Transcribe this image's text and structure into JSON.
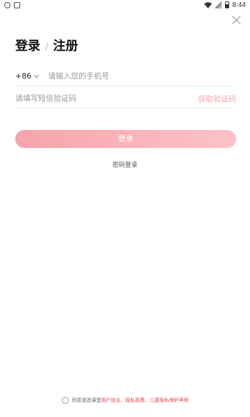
{
  "status_bar": {
    "time": "8:44",
    "left_icons": [
      "message-bubble-icon",
      "a-box-icon"
    ],
    "right_icons": [
      "wifi-icon",
      "no-signal-icon",
      "battery-icon"
    ]
  },
  "header": {
    "title_login": "登录",
    "title_sep": "/",
    "title_register": "注册"
  },
  "phone": {
    "country_code": "+86",
    "placeholder": "请输入您的手机号",
    "value": ""
  },
  "sms": {
    "placeholder": "请填写短信验证码",
    "value": "",
    "get_code_label": "获取验证码"
  },
  "login_button": "登录",
  "password_login": "密码登录",
  "agreement": {
    "prefix": "同意道选课堂",
    "user_agreement": "用户协议",
    "sep1": "、",
    "privacy_policy": "隐私政策",
    "sep2": "、",
    "children_privacy": "儿童隐私保护声明"
  },
  "colors": {
    "accent": "#e8404a",
    "button_start": "#f7a3ab",
    "button_end": "#fbc3c7",
    "get_code": "#f2a8ad"
  }
}
